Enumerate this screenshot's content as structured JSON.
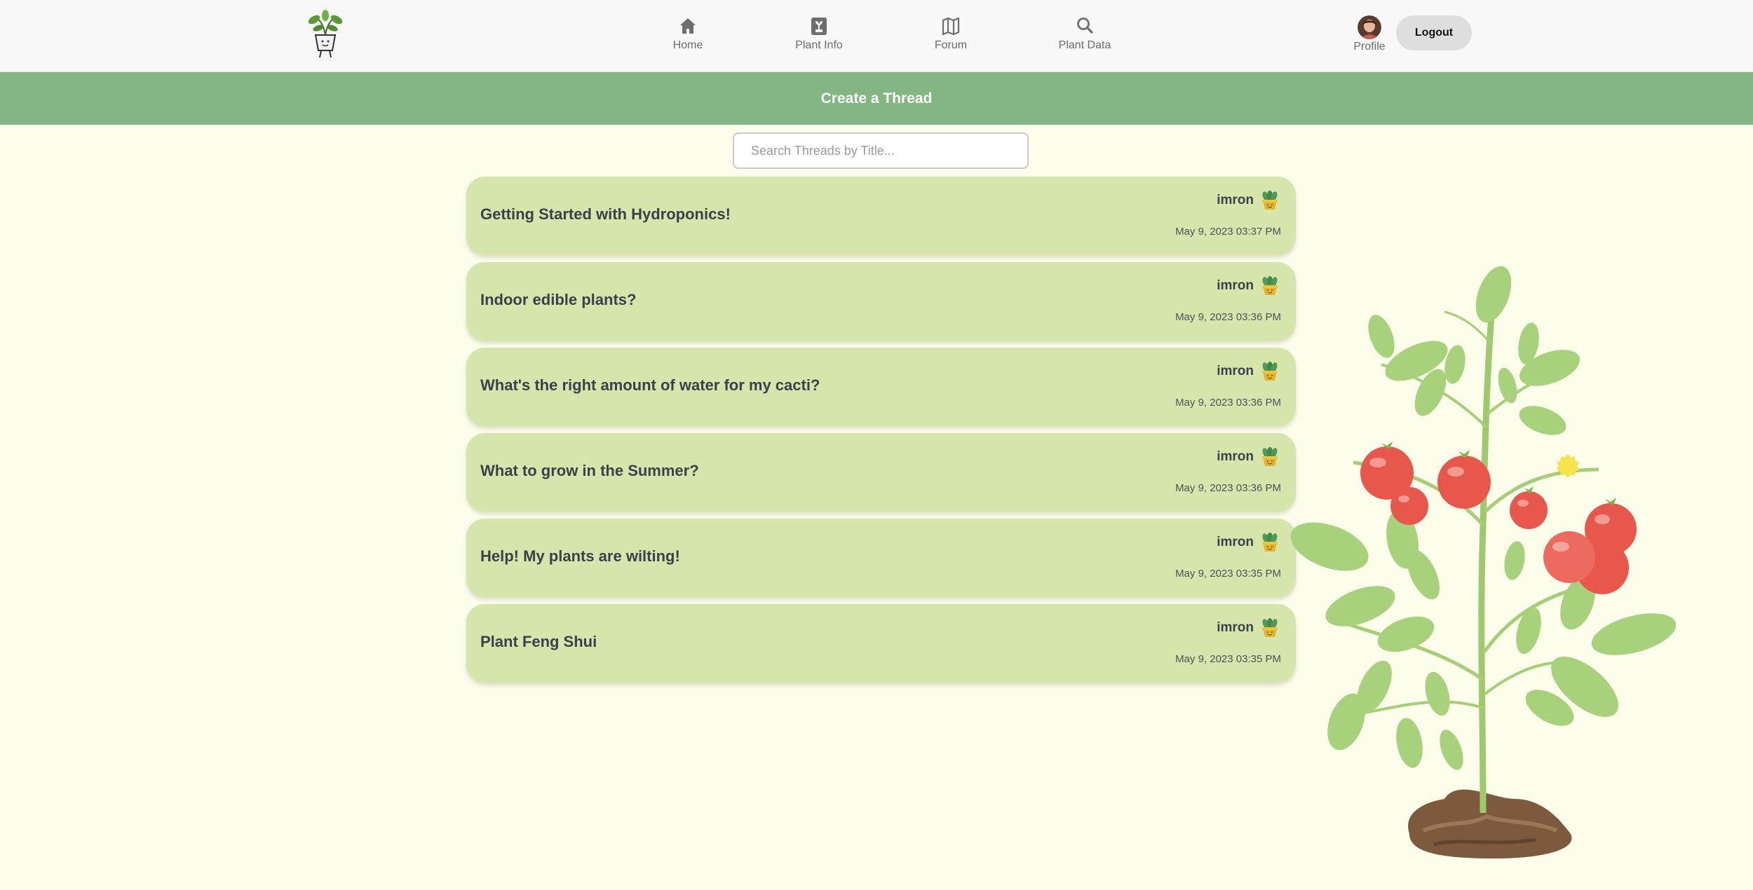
{
  "nav": {
    "items": [
      {
        "label": "Home",
        "icon": "home-icon"
      },
      {
        "label": "Plant Info",
        "icon": "plant-info-icon"
      },
      {
        "label": "Forum",
        "icon": "map-icon"
      },
      {
        "label": "Plant Data",
        "icon": "search-icon"
      }
    ],
    "profile_label": "Profile",
    "logout_label": "Logout"
  },
  "create_thread_label": "Create a Thread",
  "search": {
    "placeholder": "Search Threads by Title..."
  },
  "threads": [
    {
      "title": "Getting Started with Hydroponics!",
      "author": "imron",
      "date": "May 9, 2023 03:37 PM"
    },
    {
      "title": "Indoor edible plants?",
      "author": "imron",
      "date": "May 9, 2023 03:36 PM"
    },
    {
      "title": "What's the right amount of water for my cacti?",
      "author": "imron",
      "date": "May 9, 2023 03:36 PM"
    },
    {
      "title": "What to grow in the Summer?",
      "author": "imron",
      "date": "May 9, 2023 03:36 PM"
    },
    {
      "title": "Help! My plants are wilting!",
      "author": "imron",
      "date": "May 9, 2023 03:35 PM"
    },
    {
      "title": "Plant Feng Shui",
      "author": "imron",
      "date": "May 9, 2023 03:35 PM"
    }
  ],
  "colors": {
    "background": "#fdfdec",
    "navbar": "#f8f8f8",
    "create_bar": "#84b683",
    "thread_card": "#d6e5ab",
    "title_text": "#3b404a"
  }
}
